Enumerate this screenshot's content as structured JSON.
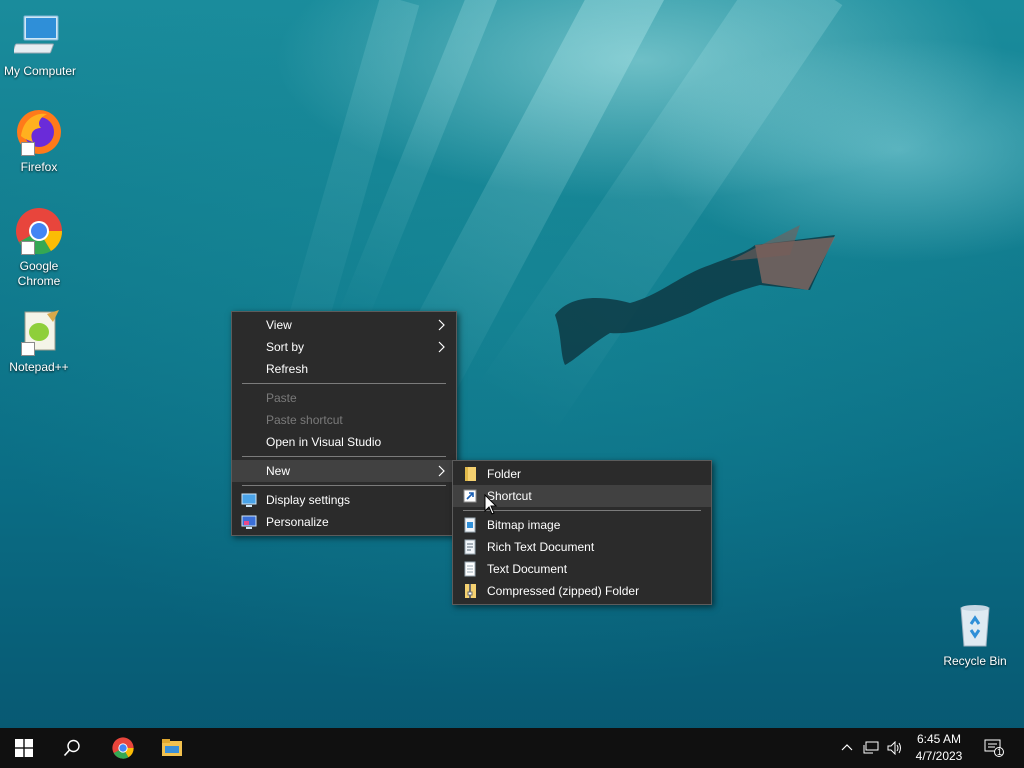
{
  "desktop_icons": [
    {
      "label": "My Computer",
      "icon": "computer-icon"
    },
    {
      "label": "Firefox",
      "icon": "firefox-icon"
    },
    {
      "label": "Google Chrome",
      "icon": "chrome-icon"
    },
    {
      "label": "Notepad++",
      "icon": "notepadpp-icon"
    },
    {
      "label": "Recycle Bin",
      "icon": "recycle-bin-icon"
    }
  ],
  "context_menu": {
    "view": "View",
    "sort_by": "Sort by",
    "refresh": "Refresh",
    "paste": "Paste",
    "paste_shortcut": "Paste shortcut",
    "open_vs": "Open in Visual Studio",
    "new": "New",
    "display_settings": "Display settings",
    "personalize": "Personalize"
  },
  "new_submenu": {
    "folder": "Folder",
    "shortcut": "Shortcut",
    "bitmap": "Bitmap image",
    "rtf": "Rich Text Document",
    "text": "Text Document",
    "zip": "Compressed (zipped) Folder"
  },
  "taskbar": {
    "time": "6:45 AM",
    "date": "4/7/2023",
    "notification_count": "1"
  },
  "colors": {
    "menu_bg": "#2b2b2b",
    "menu_hover": "#414141",
    "taskbar_bg": "#101010"
  }
}
